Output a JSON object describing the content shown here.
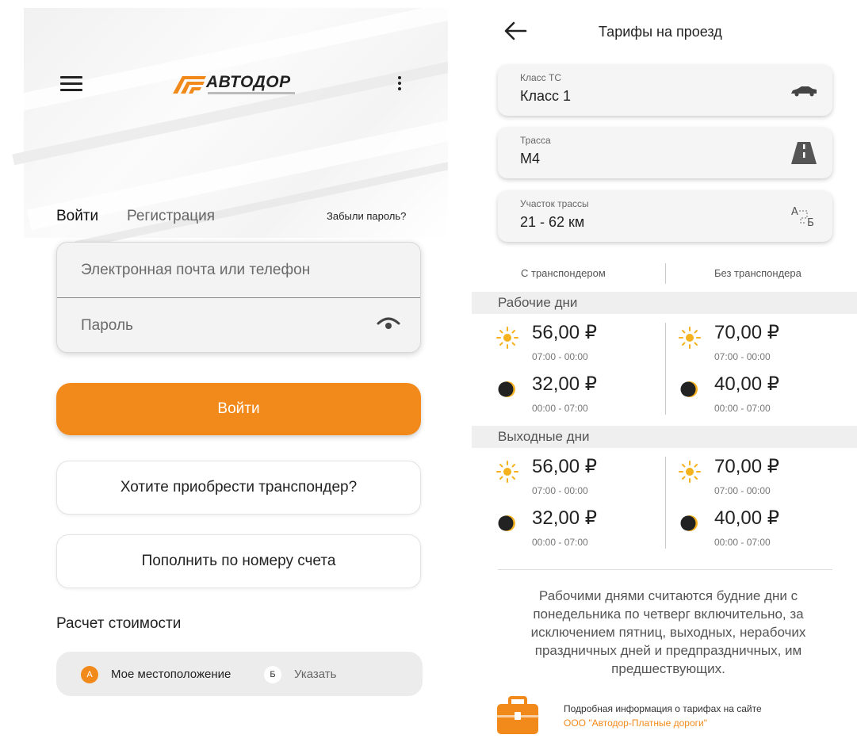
{
  "colors": {
    "accent": "#f28a1b",
    "sun": "#f5b21e",
    "moon": "#222222"
  },
  "login_screen": {
    "menu_icon": "hamburger-icon",
    "more_icon": "more-vertical-icon",
    "logo_text": "АВТОДОР",
    "tabs": {
      "login": "Войти",
      "register": "Регистрация"
    },
    "forgot_password": "Забыли пароль?",
    "email_placeholder": "Электронная почта или телефон",
    "password_placeholder": "Пароль",
    "login_button": "Войти",
    "transponder_button": "Хотите приобрести транспондер?",
    "topup_button": "Пополнить по номеру счета",
    "calc_title": "Расчет стоимости",
    "route": {
      "a_marker": "А",
      "a_label": "Мое местоположение",
      "b_marker": "Б",
      "b_label": "Указать"
    }
  },
  "tariff_screen": {
    "title": "Тарифы на проезд",
    "selectors": [
      {
        "caption": "Класс ТС",
        "value": "Класс 1",
        "icon": "car-icon"
      },
      {
        "caption": "Трасса",
        "value": "М4",
        "icon": "road-icon"
      },
      {
        "caption": "Участок трассы",
        "value": "21 - 62 км",
        "icon": "route-segment-icon"
      }
    ],
    "columns": {
      "with": "С транспондером",
      "without": "Без транспондера"
    },
    "sections": [
      {
        "title": "Рабочие дни",
        "with": [
          {
            "period": "day",
            "price": "56,00 ₽",
            "time": "07:00 - 00:00"
          },
          {
            "period": "night",
            "price": "32,00 ₽",
            "time": "00:00 - 07:00"
          }
        ],
        "without": [
          {
            "period": "day",
            "price": "70,00 ₽",
            "time": "07:00 - 00:00"
          },
          {
            "period": "night",
            "price": "40,00 ₽",
            "time": "00:00 - 07:00"
          }
        ]
      },
      {
        "title": "Выходные дни",
        "with": [
          {
            "period": "day",
            "price": "56,00 ₽",
            "time": "07:00 - 00:00"
          },
          {
            "period": "night",
            "price": "32,00 ₽",
            "time": "00:00 - 07:00"
          }
        ],
        "without": [
          {
            "period": "day",
            "price": "70,00 ₽",
            "time": "07:00 - 00:00"
          },
          {
            "period": "night",
            "price": "40,00 ₽",
            "time": "00:00 - 07:00"
          }
        ]
      }
    ],
    "note": "Рабочими днями считаются будние дни с понедельника по четверг включительно, за исключением пятниц, выходных, нерабочих праздничных дней и предпраздничных, им предшествующих.",
    "info_text": "Подробная информация о тарифах на сайте",
    "info_link": "ООО \"Автодор-Платные дороги\""
  }
}
